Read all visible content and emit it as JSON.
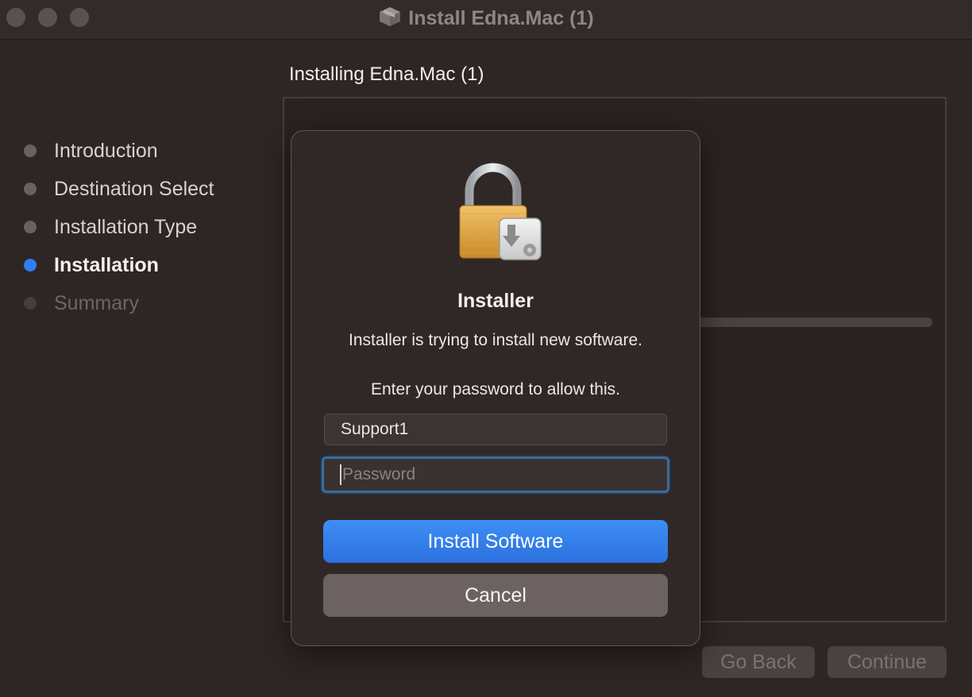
{
  "window": {
    "title": "Install Edna.Mac (1)",
    "icon": "package-icon"
  },
  "page": {
    "heading": "Installing Edna.Mac (1)"
  },
  "steps": [
    {
      "label": "Introduction",
      "state": "done"
    },
    {
      "label": "Destination Select",
      "state": "done"
    },
    {
      "label": "Installation Type",
      "state": "done"
    },
    {
      "label": "Installation",
      "state": "current"
    },
    {
      "label": "Summary",
      "state": "pending"
    }
  ],
  "footer": {
    "back_label": "Go Back",
    "continue_label": "Continue"
  },
  "dialog": {
    "icon": "lock-icon",
    "title": "Installer",
    "message": "Installer is trying to install new software.",
    "prompt": "Enter your password to allow this.",
    "username_value": "Support1",
    "password_placeholder": "Password",
    "install_label": "Install Software",
    "cancel_label": "Cancel"
  },
  "colors": {
    "accent": "#2f7ff5",
    "background": "#2e2625",
    "focus_ring": "#3d6c99"
  }
}
